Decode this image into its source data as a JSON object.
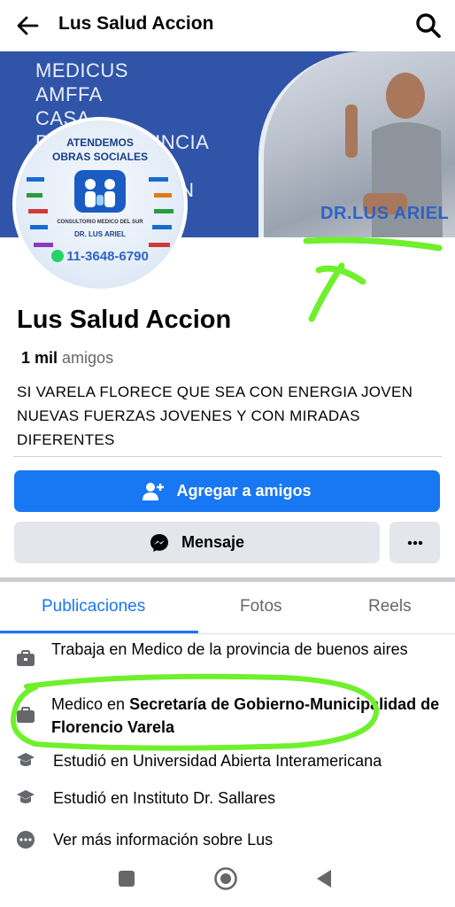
{
  "header": {
    "title": "Lus Salud Accion"
  },
  "cover": {
    "lines": [
      "MEDICUS",
      "AMFFA",
      "CASA",
      "P",
      "VINCIA",
      "AN"
    ],
    "photo_caption": "DR.LUS ARIEL"
  },
  "avatar": {
    "line1": "ATENDEMOS",
    "line2": "OBRAS SOCIALES",
    "small_text": "CONSULTORIO MEDICO DEL SUR",
    "doctor": "DR. LUS ARIEL",
    "phone": "11-3648-6790"
  },
  "profile": {
    "name": "Lus Salud Accion",
    "friends_count": "1 mil",
    "friends_label": "amigos",
    "bio": "SI VARELA FLORECE QUE SEA CON ENERGIA JOVEN NUEVAS  FUERZAS JOVENES Y CON MIRADAS DIFERENTES"
  },
  "actions": {
    "add_friend": "Agregar a amigos",
    "message": "Mensaje",
    "more": "···"
  },
  "tabs": [
    {
      "label": "Publicaciones",
      "active": true
    },
    {
      "label": "Fotos",
      "active": false
    },
    {
      "label": "Reels",
      "active": false
    }
  ],
  "info": {
    "work1": "Trabaja en Medico de la provincia de buenos aires",
    "work2_prefix": "Medico en ",
    "work2_bold": "Secretaría de Gobierno-Municipalidad de Florencio Varela",
    "study1": "Estudió en Universidad Abierta Interamericana",
    "study2": "Estudió en Instituto Dr. Sallares",
    "more_info": "Ver más información sobre Lus"
  },
  "colors": {
    "accent": "#1877f2",
    "cover": "#2f54a8",
    "highlight": "#6ef02c"
  },
  "icons": [
    "back-arrow-icon",
    "search-icon",
    "add-friend-icon",
    "messenger-icon",
    "more-icon",
    "briefcase-icon",
    "graduation-cap-icon",
    "more-circle-icon",
    "square-nav-icon",
    "circle-nav-icon",
    "triangle-nav-icon"
  ]
}
